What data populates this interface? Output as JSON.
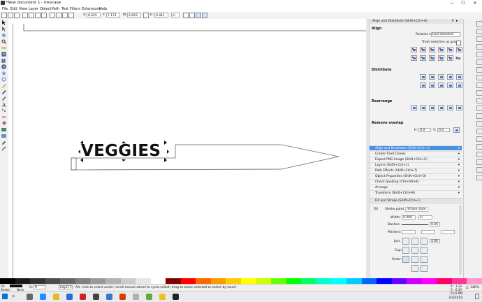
{
  "window": {
    "title": "*New document 1 - Inkscape",
    "minimize": "—",
    "maximize": "☐",
    "close": "✕"
  },
  "menubar": [
    "File",
    "Edit",
    "View",
    "Layer",
    "Object",
    "Path",
    "Text",
    "Filters",
    "Extensions",
    "Help"
  ],
  "toolcontrols": {
    "x_label": "X:",
    "x_value": "0.525",
    "y_label": "Y:",
    "y_value": "7.171",
    "w_label": "W:",
    "w_value": "2.063",
    "h_label": "H:",
    "h_value": "0.411",
    "unit": "in"
  },
  "canvas": {
    "sign_text": "VEGGIES"
  },
  "align_panel": {
    "title": "Align and Distribute (Shift+Ctrl+A)",
    "align_heading": "Align",
    "relative_to_label": "Relative to:",
    "relative_to_value": "Last selected",
    "treat_as_group": "Treat selection as group:",
    "distribute_heading": "Distribute",
    "rearrange_heading": "Rearrange",
    "remove_overlap_heading": "Remove overlap",
    "h_label": "H:",
    "h_value": "0.0",
    "v_label": "V:",
    "v_value": "0.0"
  },
  "dialogs": [
    "Align and Distribute (Shift+Ctrl+A)",
    "Create Tiled Clones",
    "Export PNG Image (Shift+Ctrl+E)",
    "Layers (Shift+Ctrl+L)",
    "Path Effects  (Shift+Ctrl+7)",
    "Object Properties (Shift+Ctrl+O)",
    "Check Spelling (Ctrl+Alt+K)",
    "Arrange",
    "Transform (Shift+Ctrl+M)"
  ],
  "fill_stroke": {
    "title": "Fill and Stroke (Shift+Ctrl+F)",
    "tab_fill": "Fill",
    "tab_paint": "Stroke paint",
    "tab_style": "Stroke style",
    "width_label": "Width:",
    "width_value": "0.000",
    "width_unit": "in",
    "dashes_label": "Dashes:",
    "dashes_value": "0.00",
    "markers_label": "Markers:",
    "join_label": "Join:",
    "join_value": "4.00",
    "cap_label": "Cap:",
    "order_label": "Order:"
  },
  "palette_colors": [
    "#000000",
    "#1a1a1a",
    "#333333",
    "#4d4d4d",
    "#666666",
    "#808080",
    "#999999",
    "#b3b3b3",
    "#cccccc",
    "#e6e6e6",
    "#ffffff",
    "#800000",
    "#ff0000",
    "#ff6600",
    "#ff9900",
    "#ffcc00",
    "#ffff00",
    "#ccff00",
    "#66ff00",
    "#00ff00",
    "#00ff66",
    "#00ffcc",
    "#00ffff",
    "#00ccff",
    "#0066ff",
    "#0000ff",
    "#6600ff",
    "#cc00ff",
    "#ff00ff",
    "#ff0066",
    "#ff3399",
    "#ff99cc"
  ],
  "statusbar": {
    "fill_label": "Fill:",
    "stroke_label": "Stroke:",
    "stroke_value": "None",
    "opacity_label": "O:",
    "opacity_value": "0",
    "layer": "Layer 1",
    "message": "Alt: click to select under; scroll mouse-wheel to cycle-select; drag to move selected or select by touch",
    "x_label": "X:",
    "x_value": "3.33",
    "y_label": "Y:",
    "y_value": "6.33",
    "z_label": "Z:",
    "zoom_value": "140%"
  },
  "taskbar": {
    "time": "3:10 PM",
    "date": "3/4/2020",
    "search_icon": "⌕"
  }
}
